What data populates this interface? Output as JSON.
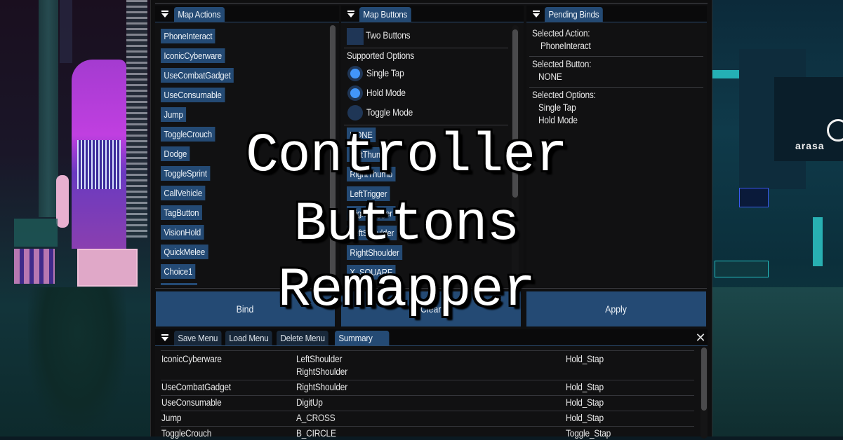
{
  "overlay": {
    "lines": [
      "Controller",
      "Buttons",
      "Remapper"
    ]
  },
  "map_actions": {
    "tab_label": "Map Actions",
    "items": [
      "PhoneInteract",
      "IconicCyberware",
      "UseCombatGadget",
      "UseConsumable",
      "Jump",
      "ToggleCrouch",
      "Dodge",
      "ToggleSprint",
      "CallVehicle",
      "TagButton",
      "VisionHold",
      "QuickMelee",
      "Choice1"
    ]
  },
  "map_buttons": {
    "tab_label": "Map Buttons",
    "two_buttons_label": "Two Buttons",
    "two_buttons_checked": false,
    "supported_options_label": "Supported Options",
    "options": [
      {
        "label": "Single Tap",
        "selected": true
      },
      {
        "label": "Hold Mode",
        "selected": true
      },
      {
        "label": "Toggle Mode",
        "selected": false
      }
    ],
    "buttons": [
      "NONE",
      "LeftThumb",
      "RightThumb",
      "LeftTrigger",
      "RightTrigger",
      "LeftShoulder",
      "RightShoulder",
      "X_SQUARE"
    ]
  },
  "pending_binds": {
    "tab_label": "Pending Binds",
    "selected_action_label": "Selected Action:",
    "selected_action_value": "PhoneInteract",
    "selected_button_label": "Selected Button:",
    "selected_button_value": "NONE",
    "selected_options_label": "Selected Options:",
    "selected_options_values": [
      "Single Tap",
      "Hold Mode"
    ]
  },
  "actions": {
    "bind_label": "Bind",
    "clear_label": "Clear",
    "apply_label": "Apply"
  },
  "bottom_tabs": [
    {
      "label": "Save Menu",
      "active": false
    },
    {
      "label": "Load Menu",
      "active": false
    },
    {
      "label": "Delete Menu",
      "active": false
    },
    {
      "label": "Summary",
      "active": true
    }
  ],
  "summary": {
    "rows": [
      {
        "action": "IconicCyberware",
        "buttons": [
          "LeftShoulder",
          "RightShoulder"
        ],
        "mode": "Hold_Stap"
      },
      {
        "action": "UseCombatGadget",
        "buttons": [
          "RightShoulder"
        ],
        "mode": "Hold_Stap"
      },
      {
        "action": "UseConsumable",
        "buttons": [
          "DigitUp"
        ],
        "mode": "Hold_Stap"
      },
      {
        "action": "Jump",
        "buttons": [
          "A_CROSS"
        ],
        "mode": "Hold_Stap"
      },
      {
        "action": "ToggleCrouch",
        "buttons": [
          "B_CIRCLE"
        ],
        "mode": "Toggle_Stap"
      }
    ]
  },
  "colors": {
    "accent": "#244a74",
    "radio_on": "#4296fa",
    "window_bg": "#111112"
  }
}
